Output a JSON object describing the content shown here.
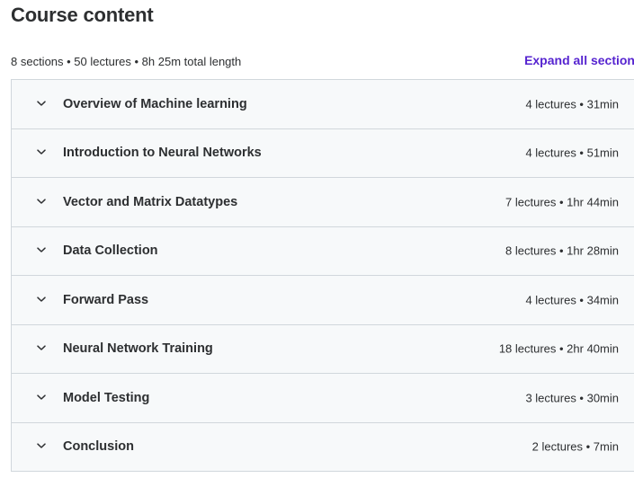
{
  "header": {
    "title": "Course content"
  },
  "summary": {
    "text": "8 sections • 50 lectures • 8h 25m total length",
    "expand_label": "Expand all section"
  },
  "sections": [
    {
      "title": "Overview of Machine learning",
      "meta": "4 lectures • 31min"
    },
    {
      "title": "Introduction to Neural Networks",
      "meta": "4 lectures • 51min"
    },
    {
      "title": "Vector and Matrix Datatypes",
      "meta": "7 lectures • 1hr 44min"
    },
    {
      "title": "Data Collection",
      "meta": "8 lectures • 1hr 28min"
    },
    {
      "title": "Forward Pass",
      "meta": "4 lectures • 34min"
    },
    {
      "title": "Neural Network Training",
      "meta": "18 lectures • 2hr 40min"
    },
    {
      "title": "Model Testing",
      "meta": "3 lectures • 30min"
    },
    {
      "title": "Conclusion",
      "meta": "2 lectures • 7min"
    }
  ],
  "icons": {
    "section_toggle": "chevron-down-icon"
  },
  "colors": {
    "accent": "#5624d0",
    "row_background": "#f7f9fa",
    "border": "#d1d7dc",
    "text": "#2d2f31"
  }
}
